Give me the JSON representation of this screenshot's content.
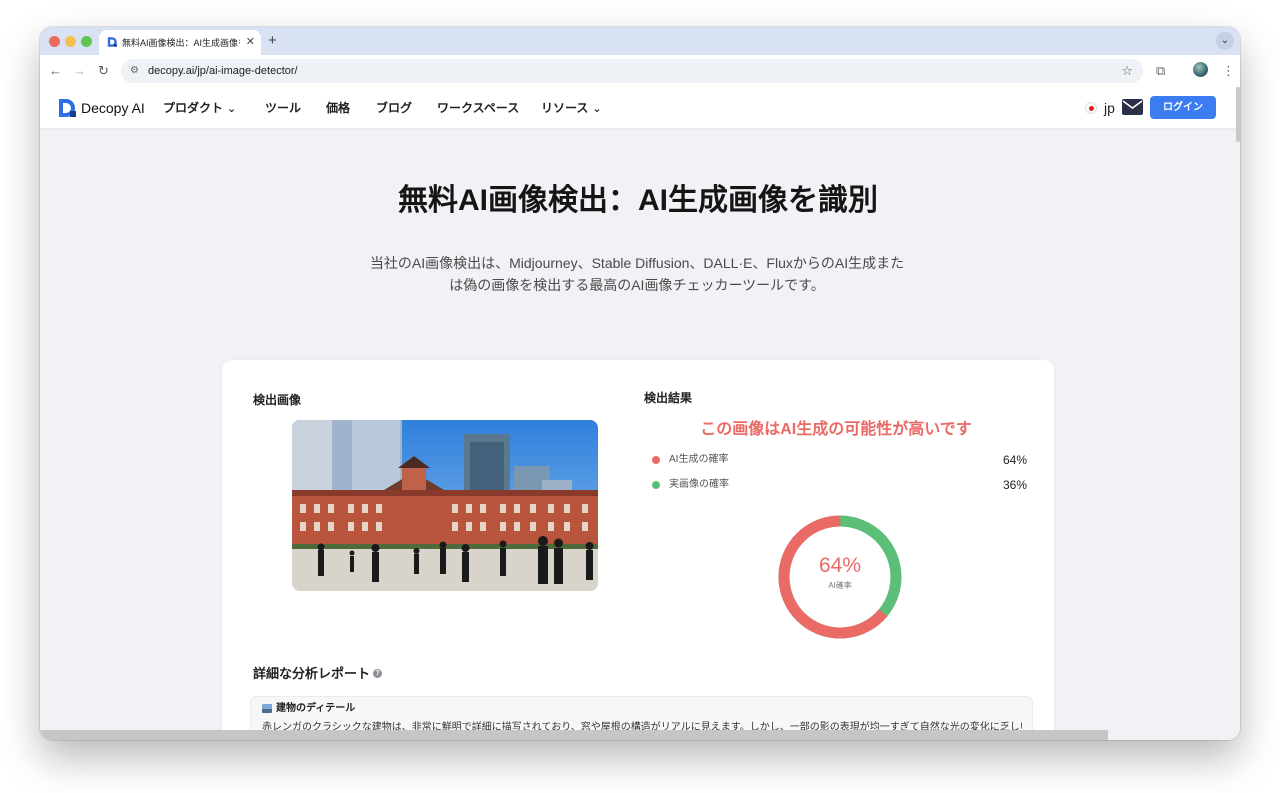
{
  "browser": {
    "tab_title": "無料AI画像検出：AI生成画像を識別",
    "tab_close": "✕",
    "new_tab": "+",
    "tab_menu": "⌄",
    "url": "decopy.ai/jp/ai-image-detector/",
    "icons": [
      "back-arrow-icon",
      "forward-arrow-icon",
      "reload-icon",
      "site-settings-icon",
      "bookmark-star-icon",
      "extensions-icon",
      "profile-avatar-icon",
      "more-menu-icon"
    ]
  },
  "site": {
    "logo_text": "Decopy AI",
    "nav": [
      {
        "label": "プロダクト",
        "has_dropdown": true
      },
      {
        "label": "ツール",
        "has_dropdown": false
      },
      {
        "label": "価格",
        "has_dropdown": false
      },
      {
        "label": "ブログ",
        "has_dropdown": false
      },
      {
        "label": "ワークスペース",
        "has_dropdown": false
      },
      {
        "label": "リソース",
        "has_dropdown": true
      }
    ],
    "lang": "jp",
    "login_label": "ログイン",
    "colors": {
      "accent": "#3b7cf0",
      "ai": "#ea6a66",
      "real": "#5cbf77",
      "page_bg": "#f1f2f6"
    }
  },
  "hero": {
    "title": "無料AI画像検出：AI生成画像を識別",
    "subtitle_line1": "当社のAI画像検出は、Midjourney、Stable Diffusion、DALL·E、FluxからのAI生成また",
    "subtitle_line2": "は偽の画像を検出する最高のAI画像チェッカーツールです。"
  },
  "detection": {
    "image_label": "検出画像",
    "result_label": "検出結果",
    "verdict": "この画像はAI生成の可能性が高いです",
    "ai_label": "AI生成の確率",
    "ai_value": "64%",
    "ai_fraction": 0.64,
    "real_label": "実画像の確率",
    "real_value": "36%",
    "donut_value": "64%",
    "donut_caption": "AI確率"
  },
  "report": {
    "title": "詳細な分析レポート",
    "help": "?",
    "item_title": "建物のディテール",
    "item_body": "赤レンガのクラシックな建物は、非常に鮮明で詳細に描写されており、窓や屋根の構造がリアルに見えます。しかし、一部の影の表現が均一すぎて自然な光の変化に乏しい部"
  }
}
